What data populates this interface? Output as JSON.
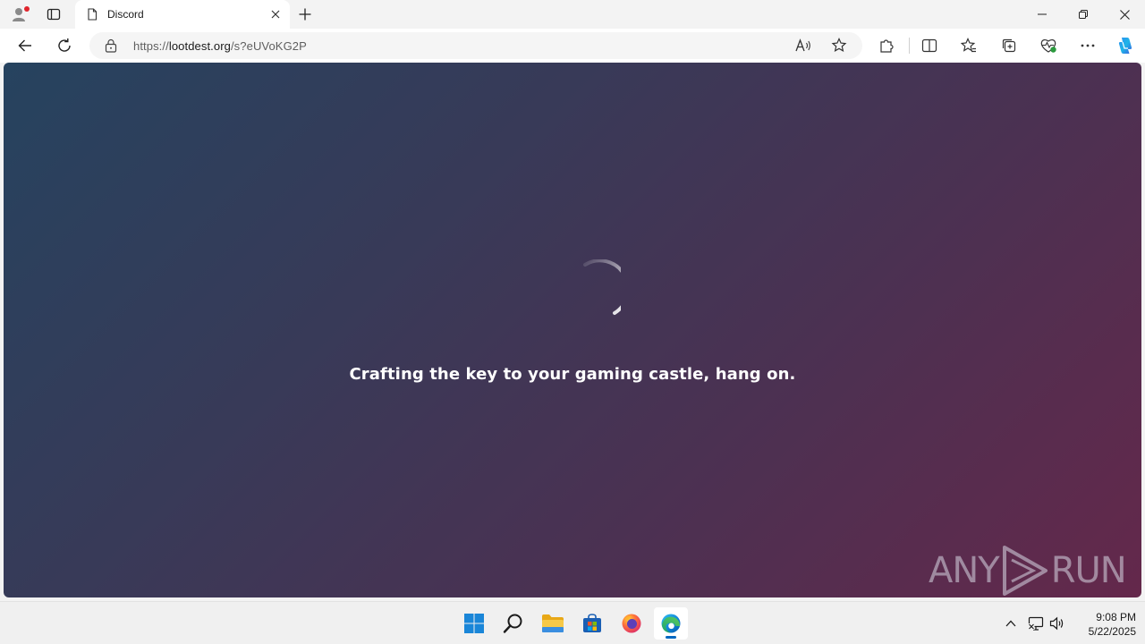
{
  "browser": {
    "tab": {
      "title": "Discord"
    },
    "address": {
      "url_prefix": "https://",
      "url_host": "lootdest.org",
      "url_path": "/s?eUVoKG2P"
    }
  },
  "page": {
    "loading_text": "Crafting the key to your gaming castle, hang on.",
    "watermark_left": "ANY",
    "watermark_right": "RUN"
  },
  "taskbar": {
    "time": "9:08 PM",
    "date": "5/22/2025"
  },
  "colors": {
    "accent": "#0067c0",
    "gradient_start": "#26435f",
    "gradient_end": "#64284b"
  }
}
